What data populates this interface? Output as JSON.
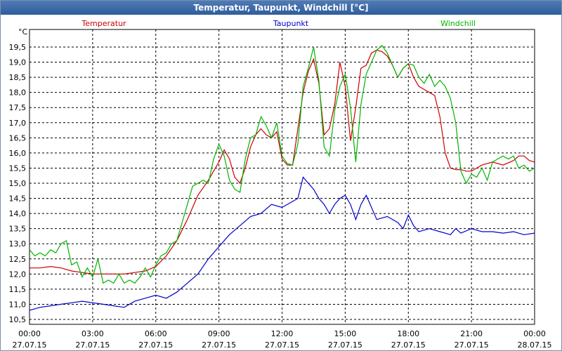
{
  "chart_data": {
    "type": "line",
    "title": "Temperatur, Taupunkt, Windchill [°C]",
    "ylabel": "°C",
    "ylim": [
      10.5,
      19.5
    ],
    "yticks": [
      "10,5",
      "11,0",
      "11,5",
      "12,0",
      "12,5",
      "13,0",
      "13,5",
      "14,0",
      "14,5",
      "15,0",
      "15,5",
      "16,0",
      "16,5",
      "17,0",
      "17,5",
      "18,0",
      "18,5",
      "19,0",
      "19,5"
    ],
    "xlim": [
      0,
      24
    ],
    "xticks": [
      {
        "time": "00:00",
        "date": "27.07.15"
      },
      {
        "time": "03:00",
        "date": "27.07.15"
      },
      {
        "time": "06:00",
        "date": "27.07.15"
      },
      {
        "time": "09:00",
        "date": "27.07.15"
      },
      {
        "time": "12:00",
        "date": "27.07.15"
      },
      {
        "time": "15:00",
        "date": "27.07.15"
      },
      {
        "time": "18:00",
        "date": "27.07.15"
      },
      {
        "time": "21:00",
        "date": "27.07.15"
      },
      {
        "time": "00:00",
        "date": "28.07.15"
      }
    ],
    "grid": true,
    "series": [
      {
        "name": "Temperatur",
        "color": "#cc0000",
        "x": [
          0,
          0.5,
          1,
          1.5,
          2,
          2.5,
          3,
          3.5,
          4,
          4.5,
          5,
          5.5,
          6,
          6.5,
          7,
          7.5,
          8,
          8.5,
          9,
          9.25,
          9.5,
          9.75,
          10,
          10.25,
          10.5,
          10.75,
          11,
          11.25,
          11.5,
          11.75,
          12,
          12.25,
          12.5,
          12.75,
          13,
          13.25,
          13.5,
          13.75,
          14,
          14.25,
          14.5,
          14.75,
          15,
          15.25,
          15.5,
          15.75,
          16,
          16.25,
          16.5,
          16.75,
          17,
          17.25,
          17.5,
          17.75,
          18,
          18.25,
          18.5,
          18.75,
          19,
          19.25,
          19.5,
          19.75,
          20,
          20.25,
          20.5,
          20.75,
          21,
          21.5,
          22,
          22.5,
          23,
          23.25,
          23.5,
          23.75,
          24
        ],
        "values": [
          12.2,
          12.2,
          12.25,
          12.2,
          12.1,
          12.05,
          12.0,
          12.0,
          12.0,
          12.0,
          12.05,
          12.1,
          12.25,
          12.6,
          13.1,
          13.8,
          14.6,
          15.1,
          15.7,
          16.1,
          15.8,
          15.2,
          15.0,
          15.5,
          16.2,
          16.6,
          16.8,
          16.6,
          16.5,
          16.7,
          15.8,
          15.6,
          15.6,
          16.8,
          18.0,
          18.7,
          19.1,
          18.3,
          16.6,
          16.8,
          17.6,
          19.0,
          18.2,
          16.4,
          17.5,
          18.8,
          18.9,
          19.3,
          19.4,
          19.35,
          19.2,
          18.9,
          18.5,
          18.8,
          18.95,
          18.5,
          18.2,
          18.1,
          18.0,
          17.9,
          17.2,
          16.0,
          15.5,
          15.45,
          15.45,
          15.4,
          15.4,
          15.6,
          15.7,
          15.6,
          15.75,
          15.9,
          15.9,
          15.75,
          15.7
        ]
      },
      {
        "name": "Taupunkt",
        "color": "#0000cc",
        "x": [
          0,
          0.5,
          1,
          1.5,
          2,
          2.5,
          3,
          3.5,
          4,
          4.5,
          5,
          5.5,
          6,
          6.5,
          7,
          7.5,
          8,
          8.5,
          9,
          9.5,
          10,
          10.5,
          11,
          11.5,
          12,
          12.5,
          12.75,
          13,
          13.25,
          13.5,
          13.75,
          14,
          14.25,
          14.5,
          14.75,
          15,
          15.25,
          15.5,
          15.75,
          16,
          16.5,
          17,
          17.5,
          17.75,
          18,
          18.25,
          18.5,
          19,
          19.5,
          20,
          20.25,
          20.5,
          21,
          21.5,
          22,
          22.5,
          23,
          23.5,
          24
        ],
        "values": [
          10.8,
          10.9,
          10.95,
          11.0,
          11.05,
          11.1,
          11.05,
          11.0,
          10.95,
          10.9,
          11.1,
          11.2,
          11.3,
          11.2,
          11.4,
          11.7,
          12.0,
          12.5,
          12.9,
          13.3,
          13.6,
          13.9,
          14.0,
          14.3,
          14.2,
          14.4,
          14.5,
          15.2,
          15.0,
          14.8,
          14.5,
          14.3,
          14.0,
          14.3,
          14.5,
          14.6,
          14.3,
          13.8,
          14.3,
          14.6,
          13.8,
          13.9,
          13.7,
          13.5,
          13.95,
          13.6,
          13.4,
          13.5,
          13.4,
          13.3,
          13.5,
          13.35,
          13.5,
          13.4,
          13.4,
          13.35,
          13.4,
          13.3,
          13.35
        ]
      },
      {
        "name": "Windchill",
        "color": "#00b400",
        "x": [
          0,
          0.25,
          0.5,
          0.75,
          1,
          1.25,
          1.5,
          1.75,
          2,
          2.25,
          2.5,
          2.75,
          3,
          3.25,
          3.5,
          3.75,
          4,
          4.25,
          4.5,
          4.75,
          5,
          5.25,
          5.5,
          5.75,
          6,
          6.25,
          6.5,
          6.75,
          7,
          7.25,
          7.5,
          7.75,
          8,
          8.25,
          8.5,
          8.75,
          9,
          9.25,
          9.5,
          9.75,
          10,
          10.25,
          10.5,
          10.75,
          11,
          11.25,
          11.5,
          11.75,
          12,
          12.25,
          12.5,
          12.75,
          13,
          13.25,
          13.5,
          13.75,
          14,
          14.25,
          14.5,
          14.75,
          15,
          15.25,
          15.5,
          15.75,
          16,
          16.25,
          16.5,
          16.75,
          17,
          17.25,
          17.5,
          17.75,
          18,
          18.25,
          18.5,
          18.75,
          19,
          19.25,
          19.5,
          19.75,
          20,
          20.25,
          20.5,
          20.75,
          21,
          21.25,
          21.5,
          21.75,
          22,
          22.25,
          22.5,
          22.75,
          23,
          23.25,
          23.5,
          23.75,
          24
        ],
        "values": [
          12.8,
          12.6,
          12.7,
          12.6,
          12.8,
          12.7,
          13.0,
          13.1,
          12.3,
          12.4,
          11.9,
          12.2,
          11.9,
          12.5,
          11.7,
          11.8,
          11.7,
          12.0,
          11.7,
          11.8,
          11.7,
          11.9,
          12.2,
          11.9,
          12.3,
          12.6,
          12.7,
          13.0,
          13.1,
          13.7,
          14.3,
          14.9,
          15.0,
          15.1,
          15.0,
          15.8,
          16.3,
          15.9,
          15.1,
          14.8,
          14.7,
          15.8,
          16.5,
          16.6,
          17.2,
          16.9,
          16.5,
          17.0,
          15.9,
          15.65,
          15.6,
          16.3,
          18.2,
          18.8,
          19.5,
          18.4,
          16.2,
          15.9,
          17.4,
          18.2,
          18.6,
          17.5,
          15.7,
          17.6,
          18.6,
          19.0,
          19.4,
          19.55,
          19.3,
          18.9,
          18.5,
          18.8,
          18.95,
          18.9,
          18.5,
          18.3,
          18.6,
          18.2,
          18.4,
          18.2,
          17.8,
          17.0,
          15.4,
          15.0,
          15.3,
          15.2,
          15.5,
          15.1,
          15.7,
          15.8,
          15.9,
          15.8,
          15.9,
          15.5,
          15.6,
          15.4,
          15.5
        ]
      }
    ]
  }
}
